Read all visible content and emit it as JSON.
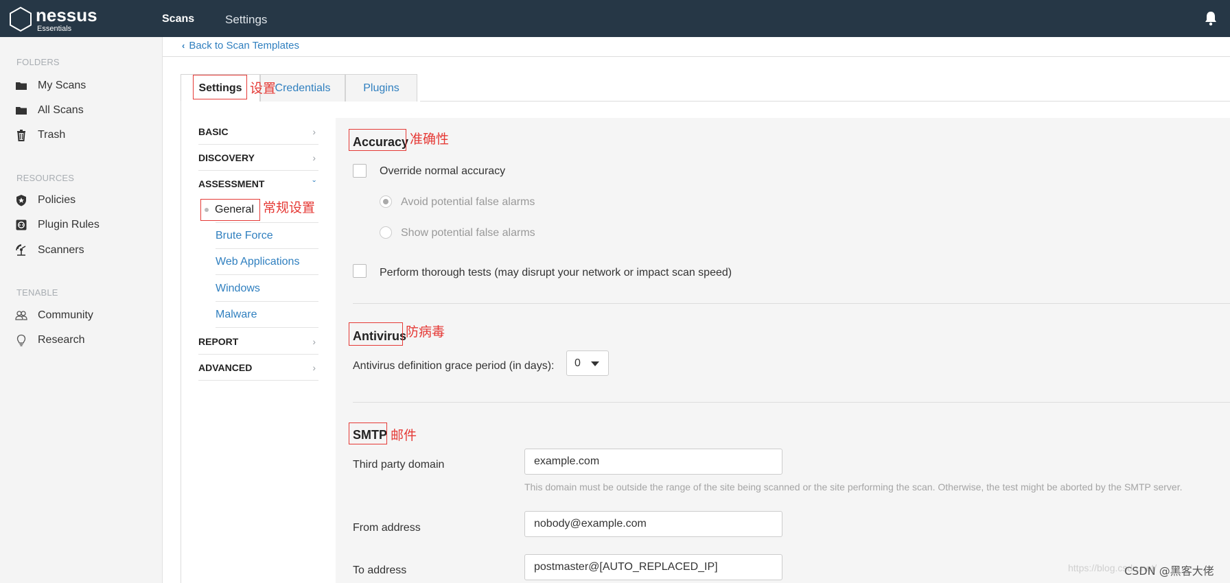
{
  "app": {
    "logo_name": "nessus",
    "logo_sub": "Essentials",
    "nav": {
      "scans": "Scans",
      "settings": "Settings"
    }
  },
  "sidebar": {
    "folders_heading": "FOLDERS",
    "folders": [
      {
        "label": "My Scans",
        "icon": "folder-icon"
      },
      {
        "label": "All Scans",
        "icon": "folder-icon"
      },
      {
        "label": "Trash",
        "icon": "trash-icon"
      }
    ],
    "resources_heading": "RESOURCES",
    "resources": [
      {
        "label": "Policies",
        "icon": "shield-icon"
      },
      {
        "label": "Plugin Rules",
        "icon": "plugin-rules-icon"
      },
      {
        "label": "Scanners",
        "icon": "scanner-icon"
      }
    ],
    "tenable_heading": "TENABLE",
    "tenable": [
      {
        "label": "Community",
        "icon": "community-icon"
      },
      {
        "label": "Research",
        "icon": "research-icon"
      }
    ]
  },
  "back_link": "Back to Scan Templates",
  "tabs": [
    "Settings",
    "Credentials",
    "Plugins"
  ],
  "settings_nav": {
    "basic": "BASIC",
    "discovery": "DISCOVERY",
    "assessment": "ASSESSMENT",
    "assessment_items": [
      "General",
      "Brute Force",
      "Web Applications",
      "Windows",
      "Malware"
    ],
    "report": "REPORT",
    "advanced": "ADVANCED"
  },
  "accuracy": {
    "title": "Accuracy",
    "override": "Override normal accuracy",
    "avoid": "Avoid potential false alarms",
    "show": "Show potential false alarms",
    "thorough": "Perform thorough tests (may disrupt your network or impact scan speed)"
  },
  "antivirus": {
    "title": "Antivirus",
    "grace_label": "Antivirus definition grace period (in days):",
    "grace_value": "0"
  },
  "smtp": {
    "title": "SMTP",
    "third_party_label": "Third party domain",
    "third_party_value": "example.com",
    "third_party_help": "This domain must be outside the range of the site being scanned or the site performing the scan. Otherwise, the test might be aborted by the SMTP server.",
    "from_label": "From address",
    "from_value": "nobody@example.com",
    "to_label": "To address",
    "to_value": "postmaster@[AUTO_REPLACED_IP]"
  },
  "annotations": {
    "settings": "设置",
    "accuracy": "准确性",
    "general": "常规设置",
    "antivirus": "防病毒",
    "smtp": "邮件"
  },
  "watermark": "https://blog.csdn.net/",
  "csdn_credit": "CSDN @黑客大佬",
  "colors": {
    "topbar": "#263746",
    "link": "#2f7fbf",
    "annotation": "#e53935",
    "panel": "#f5f5f5"
  }
}
